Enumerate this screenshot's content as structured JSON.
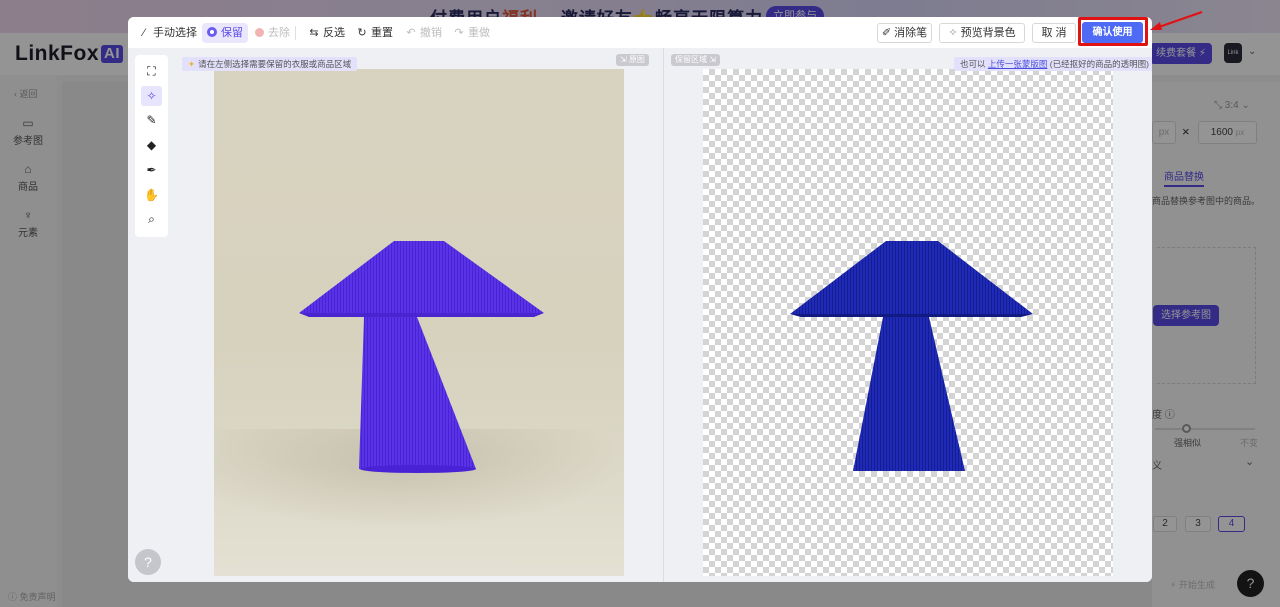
{
  "background": {
    "banner_part1": "付费用户",
    "banner_highlight": "福利",
    "banner_part2": "邀请好友",
    "banner_part3": "畅享无限算力",
    "banner_button": "立即参与",
    "logo_text": "LinkFox",
    "logo_ai": "AI",
    "renew_button": "续费套餐 ⚡",
    "avatar_text": "Link Fox",
    "sidebar": {
      "back": "返回",
      "items": [
        {
          "icon": "image-icon",
          "glyph": "▭",
          "label": "参考图"
        },
        {
          "icon": "bag-icon",
          "glyph": "🔒︎",
          "label": "商品"
        },
        {
          "icon": "element-icon",
          "glyph": "♆",
          "label": "元素"
        }
      ],
      "footer": "免责声明"
    },
    "panel": {
      "ratio": "3:4",
      "height_value": "1600",
      "height_unit": "px",
      "width_unit": "px",
      "multiply": "×",
      "tab_replace": "商品替换",
      "replace_desc": "商品替换参考图中的商品。",
      "choose_ref": "选择参考图",
      "similarity": "度",
      "strong_similar": "强相似",
      "unchanged": "不变",
      "custom": "义",
      "counts": [
        "2",
        "3",
        "4"
      ],
      "generate": "开始生成"
    },
    "help": "?"
  },
  "toolbar": {
    "manual_select": "手动选择",
    "keep": "保留",
    "remove": "去除",
    "invert": "反选",
    "reset": "重置",
    "undo": "撤销",
    "redo": "重做",
    "eraser_pen": "消除笔",
    "preview_bg": "预览背景色",
    "cancel": "取 消",
    "confirm": "确认使用"
  },
  "tools": [
    {
      "name": "smart-select-tool",
      "glyph": "⛶",
      "selected": false
    },
    {
      "name": "magic-wand-tool",
      "glyph": "✧",
      "selected": true
    },
    {
      "name": "brush-tool",
      "glyph": "🖌︎",
      "selected": false
    },
    {
      "name": "eraser-tool",
      "glyph": "◆",
      "selected": false
    },
    {
      "name": "pen-tool",
      "glyph": "✒︎",
      "selected": false
    },
    {
      "name": "hand-tool",
      "glyph": "✋︎",
      "selected": false
    },
    {
      "name": "zoom-tool",
      "glyph": "⌕",
      "selected": false
    }
  ],
  "left": {
    "hint": "请在左侧选择需要保留的衣服或商品区域",
    "tag": "原图"
  },
  "right": {
    "tag": "保留区域",
    "hint_prefix": "也可以",
    "hint_link": "上传一张蒙版图",
    "hint_suffix": "(已经抠好的商品的透明图)"
  },
  "colors": {
    "accent": "#5b4be8",
    "confirm": "#4f6bf5",
    "highlight_frame": "#e01212",
    "lamp_left": "#5a33e6",
    "lamp_right": "#1f2bb8"
  },
  "modal_help": "?"
}
